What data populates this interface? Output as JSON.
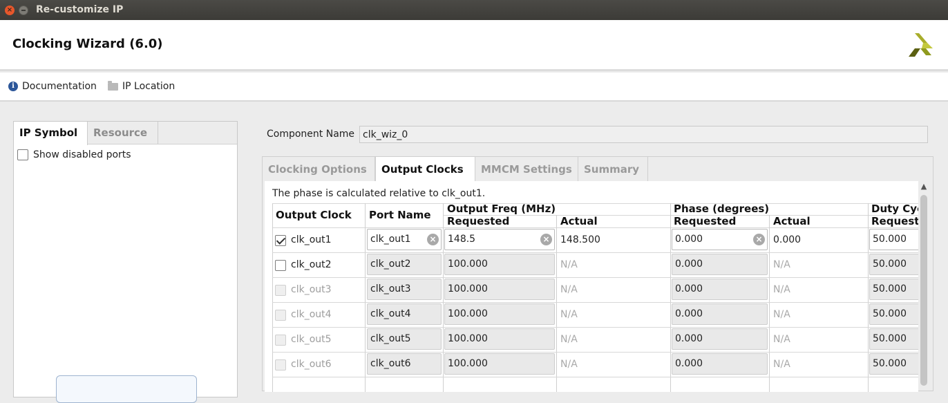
{
  "window": {
    "title": "Re-customize IP",
    "close_glyph": "×"
  },
  "header": {
    "title": "Clocking Wizard (6.0)",
    "logo_colors": [
      "#c3c83d",
      "#8f9a1e",
      "#5b6012"
    ]
  },
  "toolbar": {
    "documentation": {
      "label": "Documentation",
      "icon": "info-icon"
    },
    "ip_location": {
      "label": "IP Location",
      "icon": "folder-icon"
    }
  },
  "left_panel": {
    "tabs": [
      {
        "label": "IP Symbol",
        "active": true
      },
      {
        "label": "Resource",
        "active": false
      }
    ],
    "show_disabled_ports": {
      "label": "Show disabled ports",
      "checked": false
    }
  },
  "component": {
    "label": "Component Name",
    "value": "clk_wiz_0"
  },
  "tabs": [
    {
      "label": "Clocking Options",
      "active": false
    },
    {
      "label": "Output Clocks",
      "active": true
    },
    {
      "label": "MMCM Settings",
      "active": false
    },
    {
      "label": "Summary",
      "active": false
    }
  ],
  "output_clocks": {
    "note": "The phase is calculated relative to clk_out1.",
    "headers": {
      "output_clock": "Output Clock",
      "port_name": "Port Name",
      "output_freq": "Output Freq (MHz)",
      "phase": "Phase (degrees)",
      "duty_cycle": "Duty Cyc",
      "requested": "Requested",
      "actual": "Actual",
      "duty_requested": "Requeste"
    },
    "rows": [
      {
        "clock": "clk_out1",
        "checked": true,
        "enabled": true,
        "port": "clk_out1",
        "freq_req": "148.5",
        "freq_act": "148.500",
        "phase_req": "0.000",
        "phase_act": "0.000",
        "duty": "50.000"
      },
      {
        "clock": "clk_out2",
        "checked": false,
        "enabled": true,
        "port": "clk_out2",
        "freq_req": "100.000",
        "freq_act": "N/A",
        "phase_req": "0.000",
        "phase_act": "N/A",
        "duty": "50.000"
      },
      {
        "clock": "clk_out3",
        "checked": false,
        "enabled": false,
        "port": "clk_out3",
        "freq_req": "100.000",
        "freq_act": "N/A",
        "phase_req": "0.000",
        "phase_act": "N/A",
        "duty": "50.000"
      },
      {
        "clock": "clk_out4",
        "checked": false,
        "enabled": false,
        "port": "clk_out4",
        "freq_req": "100.000",
        "freq_act": "N/A",
        "phase_req": "0.000",
        "phase_act": "N/A",
        "duty": "50.000"
      },
      {
        "clock": "clk_out5",
        "checked": false,
        "enabled": false,
        "port": "clk_out5",
        "freq_req": "100.000",
        "freq_act": "N/A",
        "phase_req": "0.000",
        "phase_act": "N/A",
        "duty": "50.000"
      },
      {
        "clock": "clk_out6",
        "checked": false,
        "enabled": false,
        "port": "clk_out6",
        "freq_req": "100.000",
        "freq_act": "N/A",
        "phase_req": "0.000",
        "phase_act": "N/A",
        "duty": "50.000"
      }
    ]
  }
}
